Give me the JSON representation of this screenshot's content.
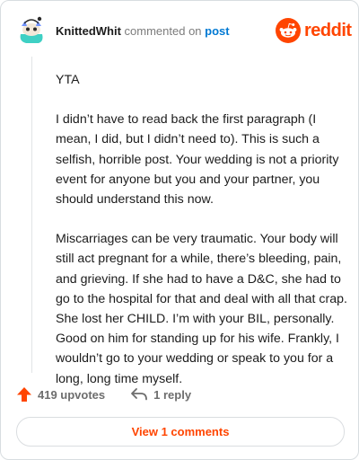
{
  "header": {
    "username": "KnittedWhit",
    "verb": "commented on",
    "post_link": "post",
    "logo_text": "reddit"
  },
  "comment": {
    "paragraphs": [
      "YTA",
      "I didn’t have to read back the first paragraph (I mean, I did, but I didn’t need to). This is such a selfish, horrible post. Your wedding is not a priority event for anyone but you and your partner, you should understand this now.",
      "Miscarriages can be very traumatic. Your body will still act pregnant for a while, there’s bleeding, pain, and grieving. If she had to have a D&C, she had to go to the hospital for that and deal with all that crap. She lost her CHILD. I’m with your BIL, personally. Good on him for standing up for his wife. Frankly, I wouldn’t go to your wedding or speak to you for a long, long time myself."
    ]
  },
  "footer": {
    "upvotes": "419 upvotes",
    "replies": "1 reply",
    "view_comments": "View 1 comments"
  },
  "icons": {
    "avatar": "snoo-avatar-icon",
    "logo": "reddit-snoo-icon",
    "upvote": "upvote-arrow-icon",
    "reply": "reply-arrow-icon"
  },
  "colors": {
    "brand": "#ff4500",
    "link": "#0079d3",
    "text": "#1c1c1c",
    "muted": "#7c7c7c",
    "border": "#d8dde0"
  }
}
